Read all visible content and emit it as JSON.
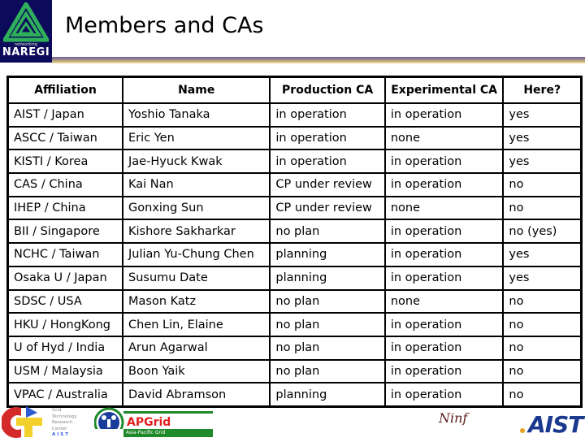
{
  "header": {
    "title": "Members and CAs",
    "logo": {
      "name": "naregi-logo",
      "text": "NAREGI",
      "subtext": "networking"
    }
  },
  "table": {
    "columns": [
      "Affiliation",
      "Name",
      "Production CA",
      "Experimental CA",
      "Here?"
    ],
    "rows": [
      [
        "AIST / Japan",
        "Yoshio Tanaka",
        "in operation",
        "in operation",
        "yes"
      ],
      [
        "ASCC / Taiwan",
        "Eric Yen",
        "in operation",
        "none",
        "yes"
      ],
      [
        "KISTI / Korea",
        "Jae-Hyuck Kwak",
        "in operation",
        "in operation",
        "yes"
      ],
      [
        "CAS / China",
        "Kai Nan",
        "CP under review",
        "in operation",
        "no"
      ],
      [
        "IHEP / China",
        "Gonxing Sun",
        "CP under review",
        "none",
        "no"
      ],
      [
        "BII / Singapore",
        "Kishore Sakharkar",
        "no plan",
        "in operation",
        "no (yes)"
      ],
      [
        "NCHC / Taiwan",
        "Julian Yu-Chung Chen",
        "planning",
        "in operation",
        "yes"
      ],
      [
        "Osaka U / Japan",
        "Susumu Date",
        "planning",
        "in operation",
        "yes"
      ],
      [
        "SDSC / USA",
        "Mason Katz",
        "no plan",
        "none",
        "no"
      ],
      [
        "HKU / HongKong",
        "Chen Lin, Elaine",
        "no plan",
        "in operation",
        "no"
      ],
      [
        "U of Hyd / India",
        "Arun Agarwal",
        "no plan",
        "in operation",
        "no"
      ],
      [
        "USM / Malaysia",
        "Boon Yaik",
        "no plan",
        "in operation",
        "no"
      ],
      [
        "VPAC / Australia",
        "David Abramson",
        "planning",
        "in operation",
        "no"
      ]
    ]
  },
  "footer": {
    "gtrc": {
      "lines": [
        "Grid",
        "Technology",
        "Research",
        "Center",
        "AIST"
      ]
    },
    "apgrid": {
      "text": "APGrid",
      "subtitle": "Asia-Pacific Grid"
    },
    "ninf": {
      "text": "Ninf"
    },
    "aist": {
      "text": "AIST"
    }
  },
  "colors": {
    "logo_bg": "#0c0a5a",
    "logo_green": "#2fae5c",
    "rule_top": "#6d6189",
    "rule_bottom": "#efe0a0",
    "apgrid_green": "#1f8a2a",
    "apgrid_red": "#e02020",
    "aist_blue": "#1b3a8f"
  }
}
